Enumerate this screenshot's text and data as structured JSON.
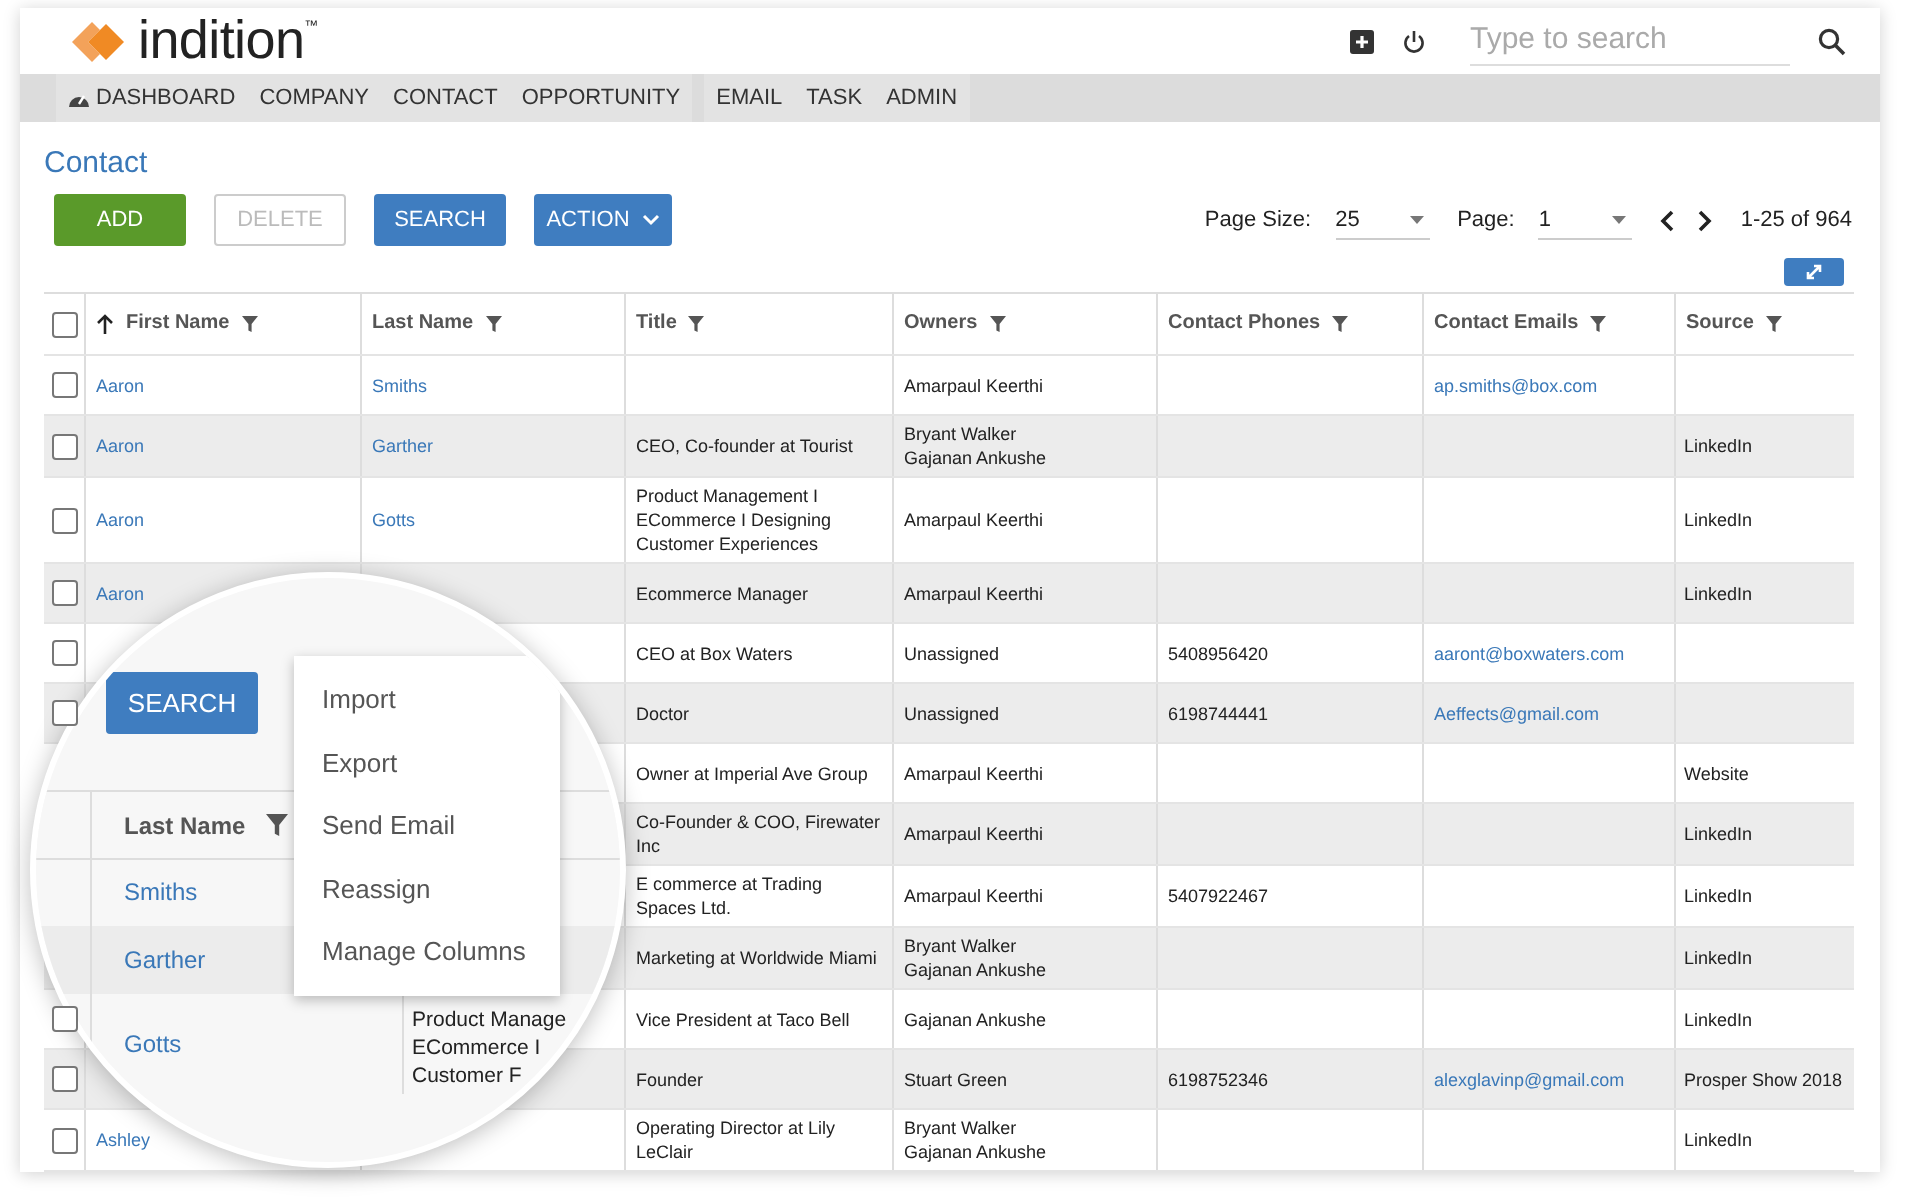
{
  "brand": {
    "name": "indition",
    "trademark": "™"
  },
  "header": {
    "search": {
      "placeholder": "Type to search"
    }
  },
  "nav": [
    {
      "label": "DASHBOARD",
      "kind": "icon"
    },
    {
      "label": "COMPANY",
      "kind": "plain"
    },
    {
      "label": "CONTACT",
      "kind": "plain"
    },
    {
      "label": "OPPORTUNITY",
      "kind": "plain"
    },
    {
      "label": "EMAIL",
      "kind": "plain"
    },
    {
      "label": "TASK",
      "kind": "plain"
    },
    {
      "label": "ADMIN",
      "kind": "plain"
    }
  ],
  "page_title": "Contact",
  "toolbar": [
    {
      "label": "ADD",
      "kind": "green",
      "disabled": false
    },
    {
      "label": "DELETE",
      "kind": "outline",
      "disabled": true
    },
    {
      "label": "SEARCH",
      "kind": "blue",
      "disabled": false
    },
    {
      "label": "ACTION",
      "kind": "dropdown",
      "disabled": false
    }
  ],
  "pagination": {
    "page_size_label": "Page Size:",
    "page_size": "25",
    "page_label": "Page:",
    "page": "1",
    "range": "1-25 of 964"
  },
  "table": {
    "header_checked": false,
    "columns": [
      {
        "label": "First Name",
        "sorted": true
      },
      {
        "label": "Last Name",
        "sorted": false
      },
      {
        "label": "Title",
        "sorted": false
      },
      {
        "label": "Owners",
        "sorted": false
      },
      {
        "label": "Contact Phones",
        "sorted": false
      },
      {
        "label": "Contact Emails",
        "sorted": false
      },
      {
        "label": "Source",
        "sorted": false
      }
    ],
    "rows": [
      {
        "checked": false,
        "first_name": "Aaron",
        "last_name": "Smiths",
        "owners": [
          "Amarpaul Keerthi"
        ],
        "email": "ap.smiths@box.com"
      },
      {
        "checked": false,
        "first_name": "Aaron",
        "last_name": "Garther",
        "title": "CEO, Co-founder at Tourist",
        "owners": [
          "Bryant Walker",
          "Gajanan Ankushe"
        ],
        "source": "LinkedIn"
      },
      {
        "checked": false,
        "first_name": "Aaron",
        "last_name": "Gotts",
        "title": "Product Management I ECommerce I Designing Customer Experiences",
        "owners": [
          "Amarpaul Keerthi"
        ],
        "source": "LinkedIn"
      },
      {
        "checked": false,
        "first_name": "Aaron",
        "title": "Ecommerce Manager",
        "owners": [
          "Amarpaul Keerthi"
        ],
        "source": "LinkedIn"
      },
      {
        "checked": false,
        "title": "CEO at Box Waters",
        "owners": [
          "Unassigned"
        ],
        "phone": "5408956420",
        "email": "aaront@boxwaters.com"
      },
      {
        "checked": false,
        "title": "Doctor",
        "owners": [
          "Unassigned"
        ],
        "phone": "6198744441",
        "email": "Aeffects@gmail.com"
      },
      {
        "title": "Owner at Imperial Ave Group",
        "owners": [
          "Amarpaul Keerthi"
        ],
        "source": "Website"
      },
      {
        "title": "Co-Founder & COO, Firewater Inc",
        "owners": [
          "Amarpaul Keerthi"
        ],
        "source": "LinkedIn"
      },
      {
        "title": "E commerce at Trading Spaces Ltd.",
        "owners": [
          "Amarpaul Keerthi"
        ],
        "phone": "5407922467",
        "source": "LinkedIn"
      },
      {
        "title": "Marketing at Worldwide Miami",
        "owners": [
          "Bryant Walker",
          "Gajanan Ankushe"
        ],
        "source": "LinkedIn"
      },
      {
        "checked": false,
        "title": "Vice President at Taco Bell",
        "owners": [
          "Gajanan Ankushe"
        ],
        "source": "LinkedIn"
      },
      {
        "checked": false,
        "title": "Founder",
        "owners": [
          "Stuart Green"
        ],
        "phone": "6198752346",
        "email": "alexglavinp@gmail.com",
        "source": "Prosper Show 2018"
      },
      {
        "checked": false,
        "first_name": "Ashley",
        "title": "Operating Director at Lily LeClair",
        "owners": [
          "Bryant Walker",
          "Gajanan Ankushe"
        ],
        "source": "LinkedIn"
      }
    ]
  },
  "magnifier": {
    "search_button": "SEARCH",
    "menu": [
      "Import",
      "Export",
      "Send Email",
      "Reassign",
      "Manage Columns"
    ],
    "column": "Last Name",
    "rows": [
      {
        "last_name": "Smiths"
      },
      {
        "last_name": "Garther"
      },
      {
        "last_name": "Gotts"
      }
    ],
    "title_fragment": [
      "Product Manage",
      "ECommerce I",
      "Customer F"
    ]
  }
}
